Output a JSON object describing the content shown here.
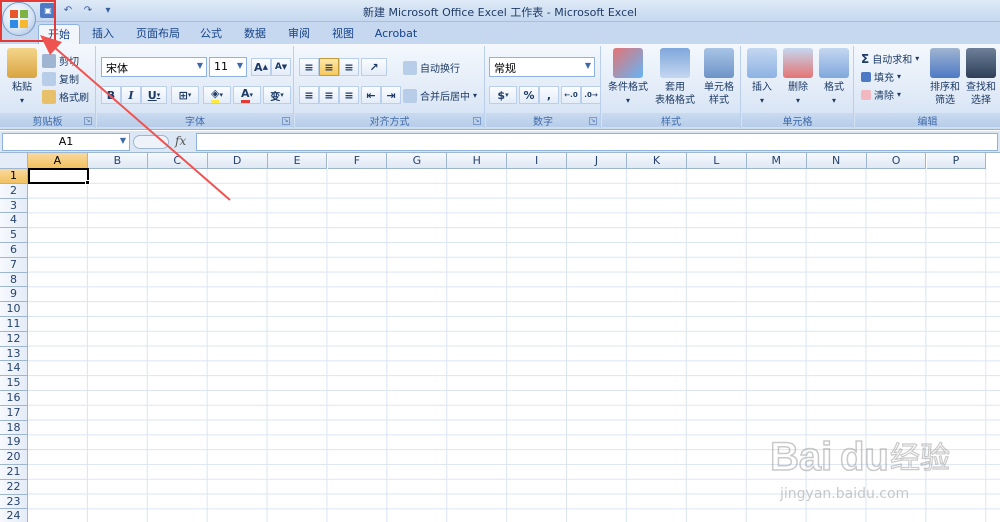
{
  "window": {
    "title": "新建 Microsoft Office Excel 工作表 - Microsoft Excel"
  },
  "office_button": {
    "icon": "office-logo-icon"
  },
  "quick_access": {
    "items": [
      "save-icon",
      "undo-icon",
      "redo-icon",
      "customize-icon"
    ]
  },
  "tabs": [
    {
      "label": "开始",
      "active": true
    },
    {
      "label": "插入"
    },
    {
      "label": "页面布局"
    },
    {
      "label": "公式"
    },
    {
      "label": "数据"
    },
    {
      "label": "审阅"
    },
    {
      "label": "视图"
    },
    {
      "label": "Acrobat"
    }
  ],
  "clipboard": {
    "label": "剪贴板",
    "paste": "粘贴",
    "cut": "剪切",
    "copy": "复制",
    "format_painter": "格式刷"
  },
  "font": {
    "label": "字体",
    "name": "宋体",
    "size": "11",
    "bold": "B",
    "italic": "I",
    "underline": "U",
    "grow": "A",
    "shrink": "A",
    "color_a": "A",
    "phonetic": "变"
  },
  "alignment": {
    "label": "对齐方式",
    "wrap_text": "自动换行",
    "merge_center": "合并后居中"
  },
  "number": {
    "label": "数字",
    "format": "常规",
    "percent": "%",
    "comma": ",",
    "inc_decimal": "+.0\n.00",
    "dec_decimal": ".00\n+.0"
  },
  "styles": {
    "label": "样式",
    "conditional": "条件格式",
    "table_format_line1": "套用",
    "table_format_line2": "表格格式",
    "cell_styles_line1": "单元格",
    "cell_styles_line2": "样式"
  },
  "cells": {
    "label": "单元格",
    "insert": "插入",
    "delete": "删除",
    "format": "格式"
  },
  "editing": {
    "label": "编辑",
    "autosum": "自动求和",
    "fill": "填充",
    "clear": "清除",
    "sort_filter_line1": "排序和",
    "sort_filter_line2": "筛选",
    "find_select_line1": "查找和",
    "find_select_line2": "选择"
  },
  "formula_bar": {
    "name_box": "A1",
    "fx": "fx",
    "value": ""
  },
  "grid": {
    "columns": [
      "A",
      "B",
      "C",
      "D",
      "E",
      "F",
      "G",
      "H",
      "I",
      "J",
      "K",
      "L",
      "M",
      "N",
      "O",
      "P"
    ],
    "rows": [
      "1",
      "2",
      "3",
      "4",
      "5",
      "6",
      "7",
      "8",
      "9",
      "10",
      "11",
      "12",
      "13",
      "14",
      "15",
      "16",
      "17",
      "18",
      "19",
      "20",
      "21",
      "22",
      "23",
      "24"
    ],
    "selected_cell": "A1"
  },
  "watermark": {
    "brand": "Bai",
    "brand2": "du",
    "text": "经验",
    "url": "jingyan.baidu.com"
  },
  "colors": {
    "ribbon_bg": "#dde8f6",
    "tab_bg": "#c5d8ef",
    "selection": "#f1c15f",
    "annotation": "#e53935"
  }
}
